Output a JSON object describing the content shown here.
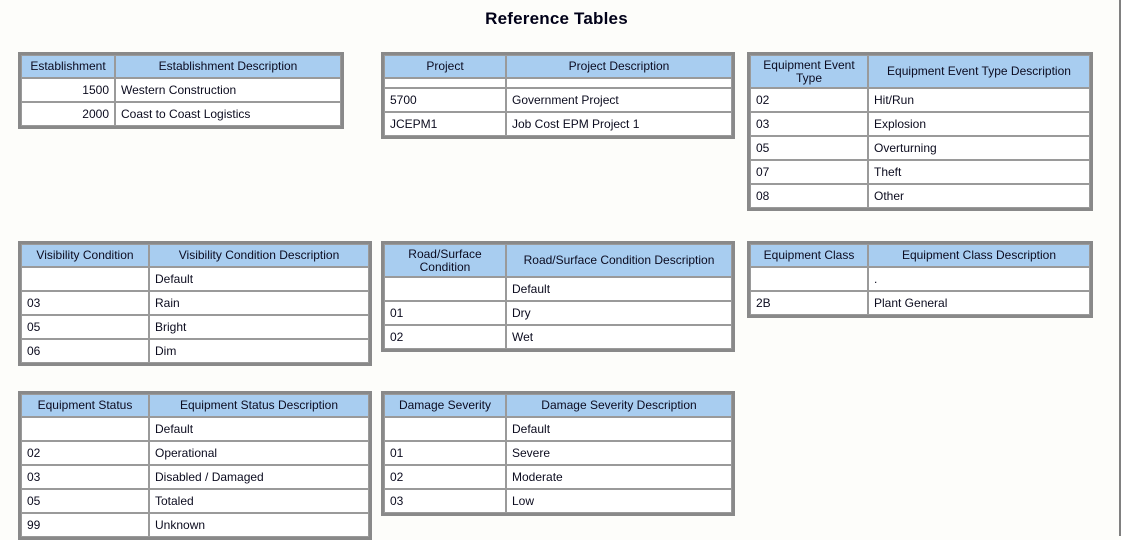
{
  "page": {
    "title": "Reference Tables",
    "background_color": "#fdfdfa",
    "header_color": "#a8cdf0",
    "border_color": "#898989"
  },
  "tables": [
    {
      "id": "establishment",
      "headers": [
        "Establishment",
        "Establishment Description"
      ],
      "header_two_line": false,
      "code_align": "right",
      "has_thin_row": false,
      "rows": [
        {
          "code": "1500",
          "description": "Western Construction"
        },
        {
          "code": "2000",
          "description": "Coast to Coast Logistics"
        }
      ]
    },
    {
      "id": "project",
      "headers": [
        "Project",
        "Project Description"
      ],
      "header_two_line": false,
      "code_align": "left",
      "has_thin_row": true,
      "rows": [
        {
          "code": "5700",
          "description": "Government Project"
        },
        {
          "code": "JCEPM1",
          "description": "Job Cost EPM Project 1"
        }
      ]
    },
    {
      "id": "equipment-event-type",
      "headers": [
        "Equipment Event Type",
        "Equipment Event Type Description"
      ],
      "header_two_line": true,
      "code_align": "left",
      "has_thin_row": false,
      "rows": [
        {
          "code": "02",
          "description": "Hit/Run"
        },
        {
          "code": "03",
          "description": "Explosion"
        },
        {
          "code": "05",
          "description": "Overturning"
        },
        {
          "code": "07",
          "description": "Theft"
        },
        {
          "code": "08",
          "description": "Other"
        }
      ]
    },
    {
      "id": "visibility-condition",
      "headers": [
        "Visibility Condition",
        "Visibility Condition Description"
      ],
      "header_two_line": false,
      "code_align": "left",
      "has_thin_row": false,
      "rows": [
        {
          "code": "",
          "description": "Default"
        },
        {
          "code": "03",
          "description": "Rain"
        },
        {
          "code": "05",
          "description": "Bright"
        },
        {
          "code": "06",
          "description": "Dim"
        }
      ]
    },
    {
      "id": "road-surface-condition",
      "headers": [
        "Road/Surface Condition",
        "Road/Surface Condition Description"
      ],
      "header_two_line": true,
      "code_align": "left",
      "has_thin_row": false,
      "rows": [
        {
          "code": "",
          "description": "Default"
        },
        {
          "code": "01",
          "description": "Dry"
        },
        {
          "code": "02",
          "description": "Wet"
        }
      ]
    },
    {
      "id": "equipment-class",
      "headers": [
        "Equipment Class",
        "Equipment Class Description"
      ],
      "header_two_line": false,
      "code_align": "left",
      "has_thin_row": false,
      "rows": [
        {
          "code": "",
          "description": "."
        },
        {
          "code": "2B",
          "description": "Plant General"
        }
      ]
    },
    {
      "id": "equipment-status",
      "headers": [
        "Equipment Status",
        "Equipment Status Description"
      ],
      "header_two_line": false,
      "code_align": "left",
      "has_thin_row": false,
      "rows": [
        {
          "code": "",
          "description": "Default"
        },
        {
          "code": "02",
          "description": "Operational"
        },
        {
          "code": "03",
          "description": "Disabled / Damaged"
        },
        {
          "code": "05",
          "description": "Totaled"
        },
        {
          "code": "99",
          "description": "Unknown"
        }
      ]
    },
    {
      "id": "damage-severity",
      "headers": [
        "Damage Severity",
        "Damage Severity Description"
      ],
      "header_two_line": false,
      "code_align": "left",
      "has_thin_row": false,
      "rows": [
        {
          "code": "",
          "description": "Default"
        },
        {
          "code": "01",
          "description": "Severe"
        },
        {
          "code": "02",
          "description": "Moderate"
        },
        {
          "code": "03",
          "description": "Low"
        }
      ]
    }
  ]
}
